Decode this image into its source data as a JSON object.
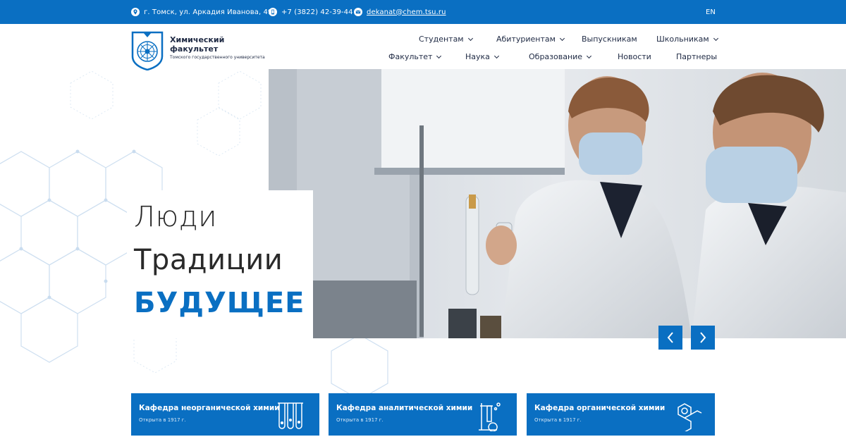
{
  "topbar": {
    "address": "г. Томск, ул. Аркадия Иванова, 49",
    "phone": "+7 (3822) 42-39-44",
    "email": "dekanat@chem.tsu.ru",
    "lang": "EN"
  },
  "logo": {
    "line1": "Химический",
    "line2": "факультет",
    "subtitle": "Томского государственного университета"
  },
  "nav": {
    "row1": [
      "Студентам",
      "Абитуриентам",
      "Выпускникам",
      "Школьникам"
    ],
    "row2": [
      "Факультет",
      "Наука",
      "Образование",
      "Новости",
      "Партнеры"
    ]
  },
  "hero": {
    "line1": "Люди",
    "line2": "Традиции",
    "line3": "БУДУЩЕЕ"
  },
  "cards": [
    {
      "title": "Кафедра неорганической химии",
      "subtitle": "Открыта в 1917 г.",
      "icon": "test-tubes-icon"
    },
    {
      "title": "Кафедра аналитической химии",
      "subtitle": "Открыта в 1917 г.",
      "icon": "lab-flask-icon"
    },
    {
      "title": "Кафедра органической химии",
      "subtitle": "Открыта в 1917 г.",
      "icon": "benzene-ring-icon"
    }
  ],
  "colors": {
    "brand": "#0a6fc2",
    "text": "#1f2a44"
  }
}
